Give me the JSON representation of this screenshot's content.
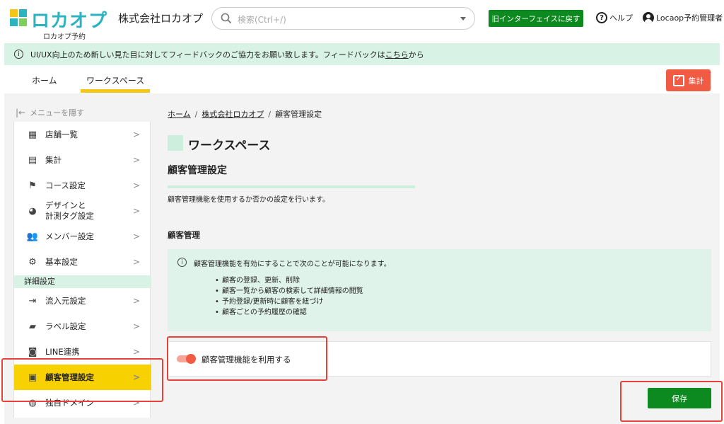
{
  "header": {
    "logo_text": "ロカオプ",
    "logo_sub": "ロカオプ予約",
    "company": "株式会社ロカオプ",
    "search_placeholder": "検索(Ctrl+/)",
    "old_ui_button": "旧インターフェイスに戻す",
    "help_label": "ヘルプ",
    "user_label": "Locaop予約管理者"
  },
  "banner": {
    "text_before": "UI/UX向上のため新しい見た目に対してフィードバックのご協力をお願い致します。フィードバックは",
    "link": "こちら",
    "text_after": "から"
  },
  "nav": {
    "tabs": [
      {
        "label": "ホーム"
      },
      {
        "label": "ワークスペース"
      }
    ],
    "tally_button": "集計"
  },
  "sidebar": {
    "hide_menu": "メニューを隠す",
    "items": [
      {
        "label": "店舗一覧"
      },
      {
        "label": "集計"
      },
      {
        "label": "コース設定"
      },
      {
        "label_line1": "デザインと",
        "label_line2": "計測タグ設定"
      },
      {
        "label": "メンバー設定"
      },
      {
        "label": "基本設定"
      },
      {
        "label": "流入元設定"
      },
      {
        "label": "ラベル設定"
      },
      {
        "label": "LINE連携"
      },
      {
        "label": "顧客管理設定"
      },
      {
        "label": "独自ドメイン"
      }
    ],
    "section_label": "詳細設定",
    "chevron": ">"
  },
  "content": {
    "breadcrumb": [
      "ホーム",
      "株式会社ロカオプ",
      "顧客管理設定"
    ],
    "breadcrumb_sep": "/",
    "workspace_title": "ワークスペース",
    "page_title": "顧客管理設定",
    "progress": 1.0,
    "description": "顧客管理機能を使用するか否かの設定を行います。",
    "section_heading": "顧客管理",
    "info_intro": "顧客管理機能を有効にすることで次のことが可能になります。",
    "info_items": [
      "顧客の登録、更新、削除",
      "顧客一覧から顧客の検索して詳細情報の閲覧",
      "予約登録/更新時に顧客を紐づけ",
      "顧客ごとの予約履歴の確認"
    ],
    "toggle_label": "顧客管理機能を利用する",
    "toggle_on": true,
    "save_button": "保存"
  },
  "colors": {
    "accent_green": "#0d8a1f",
    "brand_teal": "#2bb3c0",
    "highlight_red": "#e8413a",
    "active_yellow": "#f7d200",
    "toggle_orange": "#f15a43",
    "mint": "#d8f2e5"
  }
}
